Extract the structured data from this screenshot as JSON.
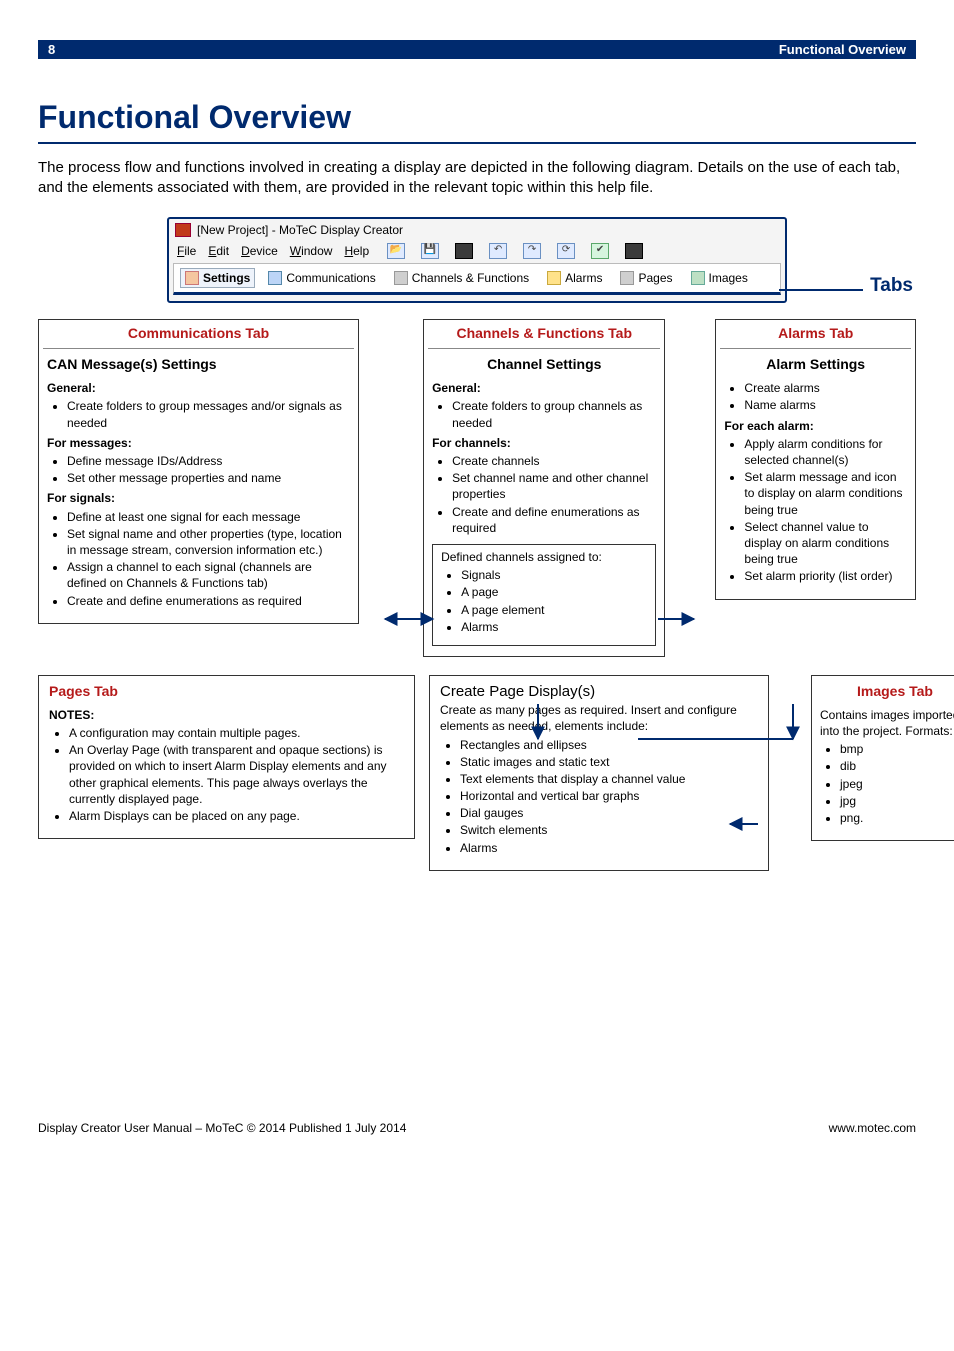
{
  "topbar": {
    "page": "8",
    "title": "Functional Overview"
  },
  "heading": "Functional Overview",
  "intro": "The process flow and functions involved in creating a display are depicted in the following diagram. Details on the use of each tab, and the elements associated with them, are provided in the relevant topic within this help file.",
  "app": {
    "title": "[New Project] - MoTeC Display Creator",
    "menu": {
      "file": "File",
      "edit": "Edit",
      "device": "Device",
      "window": "Window",
      "help": "Help"
    },
    "tabs": {
      "settings": "Settings",
      "communications": "Communications",
      "channels": "Channels & Functions",
      "alarms": "Alarms",
      "pages": "Pages",
      "images": "Images"
    },
    "tabs_label": "Tabs"
  },
  "comm": {
    "hdr": "Communications Tab",
    "sub": "CAN Message(s) Settings",
    "general_lbl": "General:",
    "general": "Create folders to group messages and/or signals as needed",
    "msgs_lbl": "For messages:",
    "msgs": [
      "Define message IDs/Address",
      "Set other message properties and name"
    ],
    "sigs_lbl": "For signals:",
    "sigs": [
      "Define at least one signal for each message",
      "Set signal name and other properties (type, location in message stream, conversion information etc.)",
      "Assign a channel to each signal (channels are defined on Channels & Functions tab)",
      "Create and define enumerations as required"
    ]
  },
  "chan": {
    "hdr": "Channels & Functions Tab",
    "sub": "Channel Settings",
    "general_lbl": "General:",
    "general": "Create folders to group channels as needed",
    "ch_lbl": "For channels:",
    "ch": [
      "Create channels",
      "Set channel name and other channel properties",
      "Create and define enumerations as required"
    ],
    "assign_lbl": "Defined channels assigned to:",
    "assign": [
      "Signals",
      "A page",
      "A page element",
      "Alarms"
    ]
  },
  "alarm": {
    "hdr": "Alarms Tab",
    "sub": "Alarm Settings",
    "top": [
      "Create alarms",
      "Name alarms"
    ],
    "each_lbl": "For each alarm:",
    "each": [
      "Apply alarm conditions for selected channel(s)",
      "Set alarm message and icon to display on alarm conditions being true",
      "Select channel value to display on alarm conditions being true",
      "Set alarm priority (list order)"
    ]
  },
  "pages": {
    "hdr": "Pages Tab",
    "notes_lbl": "NOTES:",
    "notes": [
      "A configuration may contain multiple pages.",
      "An Overlay Page (with transparent and opaque sections) is provided on which to insert Alarm Display elements and any other graphical elements. This page always overlays the currently displayed page.",
      "Alarm Displays can be placed on any page."
    ],
    "create_hdr": "Create Page Display(s)",
    "create_intro": "Create as many pages as required. Insert and configure elements as needed, elements include:",
    "create": [
      "Rectangles and ellipses",
      "Static images and static text",
      "Text elements that display a channel value",
      "Horizontal and vertical bar graphs",
      "Dial gauges",
      "Switch elements",
      "Alarms"
    ]
  },
  "images": {
    "hdr": "Images Tab",
    "intro": "Contains images imported into the project. Formats:",
    "formats": [
      "bmp",
      "dib",
      "jpeg",
      "jpg",
      "png."
    ]
  },
  "footer": {
    "left": "Display Creator User Manual – MoTeC © 2014 Published 1 July 2014",
    "right": "www.motec.com"
  }
}
